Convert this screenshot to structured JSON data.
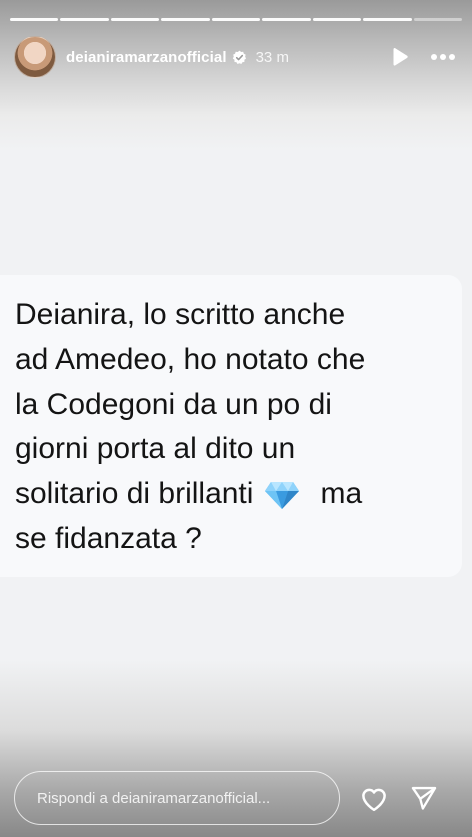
{
  "story": {
    "progress_segments": 9,
    "progress_current": 8
  },
  "header": {
    "username": "deianiramarzanofficial",
    "verified": true,
    "time": "33 m",
    "icons": {
      "verified": "verified-badge-icon",
      "play": "play-icon",
      "more": "more-options-icon"
    }
  },
  "message": {
    "line1": "Deianira, lo scritto anche",
    "line2": "ad Amedeo, ho notato che",
    "line3": "la Codegoni da un po di",
    "line4": "giorni porta al dito un",
    "line5_before_emoji": "solitario di brillanti",
    "line5_emoji": "gem-stone-emoji",
    "line5_after_emoji": "ma",
    "line6": "se fidanzata ?"
  },
  "footer": {
    "reply_placeholder": "Rispondi a deianiramarzanofficial...",
    "icons": {
      "like": "heart-icon",
      "send": "send-icon"
    }
  },
  "colors": {
    "card_background": "#f8f9fb",
    "text": "#141414",
    "header_text": "#ffffff",
    "gem": "#56b4f0"
  }
}
